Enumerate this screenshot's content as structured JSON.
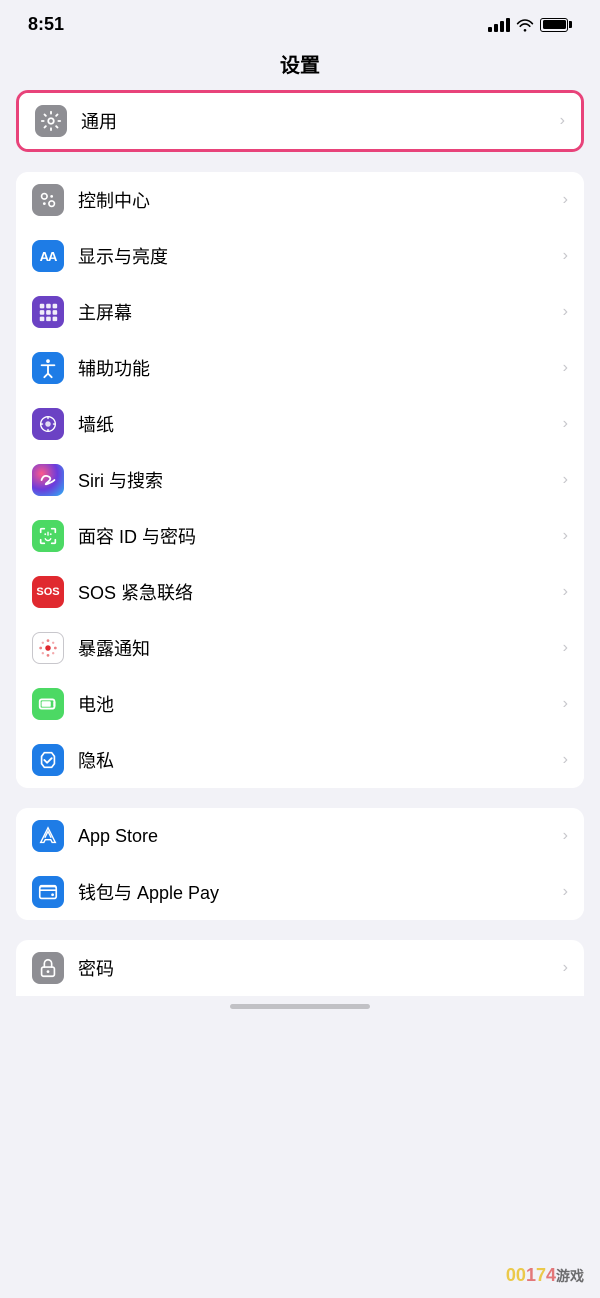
{
  "statusBar": {
    "time": "8:51"
  },
  "pageTitle": "设置",
  "sections": [
    {
      "id": "general-section",
      "highlighted": true,
      "items": [
        {
          "id": "general",
          "label": "通用",
          "iconType": "general",
          "iconClass": "icon-general"
        }
      ]
    },
    {
      "id": "main-section",
      "highlighted": false,
      "items": [
        {
          "id": "control-center",
          "label": "控制中心",
          "iconType": "control",
          "iconClass": "icon-control"
        },
        {
          "id": "display",
          "label": "显示与亮度",
          "iconType": "display",
          "iconClass": "icon-display"
        },
        {
          "id": "homescreen",
          "label": "主屏幕",
          "iconType": "homescreen",
          "iconClass": "icon-homescreen"
        },
        {
          "id": "accessibility",
          "label": "辅助功能",
          "iconType": "accessibility",
          "iconClass": "icon-accessibility"
        },
        {
          "id": "wallpaper",
          "label": "墙纸",
          "iconType": "wallpaper",
          "iconClass": "icon-wallpaper"
        },
        {
          "id": "siri",
          "label": "Siri 与搜索",
          "iconType": "siri",
          "iconClass": "icon-siri"
        },
        {
          "id": "faceid",
          "label": "面容 ID 与密码",
          "iconType": "faceid",
          "iconClass": "icon-faceid"
        },
        {
          "id": "sos",
          "label": "SOS 紧急联络",
          "iconType": "sos",
          "iconClass": "icon-sos"
        },
        {
          "id": "exposure",
          "label": "暴露通知",
          "iconType": "exposure",
          "iconClass": "icon-exposure"
        },
        {
          "id": "battery",
          "label": "电池",
          "iconType": "battery",
          "iconClass": "icon-battery"
        },
        {
          "id": "privacy",
          "label": "隐私",
          "iconType": "privacy",
          "iconClass": "icon-privacy"
        }
      ]
    },
    {
      "id": "store-section",
      "highlighted": false,
      "items": [
        {
          "id": "appstore",
          "label": "App Store",
          "iconType": "appstore",
          "iconClass": "icon-appstore"
        },
        {
          "id": "wallet",
          "label": "钱包与 Apple Pay",
          "iconType": "wallet",
          "iconClass": "icon-wallet"
        }
      ]
    }
  ],
  "bottomItem": {
    "id": "passwords",
    "label": "密码",
    "iconClass": "icon-passwords"
  },
  "watermark": "00174游戏",
  "chevron": "›"
}
